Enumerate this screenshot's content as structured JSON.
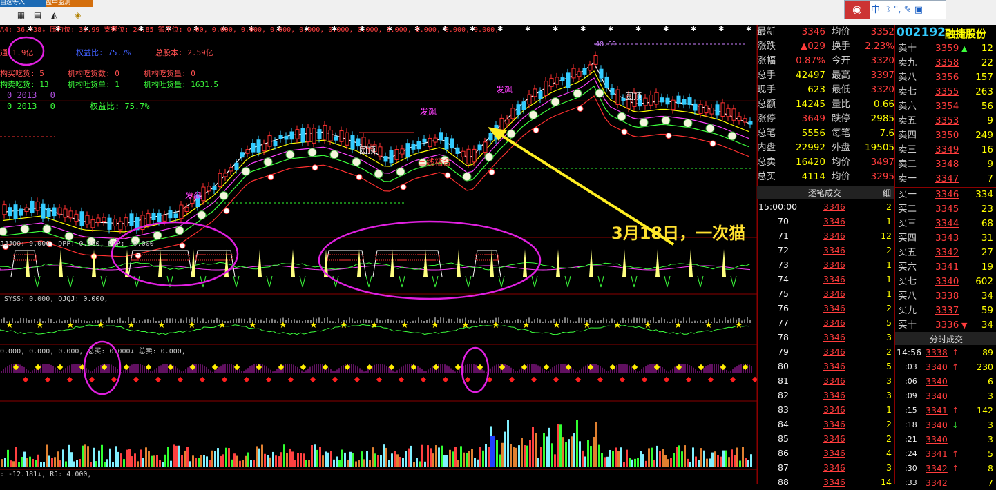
{
  "tabs": [
    {
      "label": "自选等入"
    },
    {
      "label": "盘中监测"
    }
  ],
  "toolbar": {
    "icons": [
      "grid-icon",
      "chat-icon",
      "chart-icon",
      "diamond-icon"
    ]
  },
  "qq": {
    "tools": "中 ☽ °, ✎ ▣"
  },
  "chart": {
    "header_line1": "A4: 36.438↓ 压力位: 36.99 支撑位: 24.85 警示位: 0.00, 0.000, 0.000, 0.000, 0.000, 0.000, 0.000, 0.000, 0.000, 0.000, 0.000,",
    "info": [
      {
        "text": "通 1.9亿",
        "color": "#ff5050"
      },
      {
        "text": "权益比: 75.7%",
        "color": "#4060ff"
      },
      {
        "text": "总股本: 2.59亿",
        "color": "#ff5050"
      },
      {
        "text": "构买吃货: 5",
        "color": "#ff5050"
      },
      {
        "text": "机构吃货数: 0",
        "color": "#ff5050"
      },
      {
        "text": "机构吃货量: 0",
        "color": "#ff5050"
      },
      {
        "text": "构卖吃货: 13",
        "color": "#3cff3c"
      },
      {
        "text": "机构吐货单: 1",
        "color": "#3cff3c"
      },
      {
        "text": "机构吐货量: 1631.5",
        "color": "#3cff3c"
      },
      {
        "text": "0   2013一 0",
        "color": "#b050e0"
      },
      {
        "text": "0   2013一 0",
        "color": "#3cff3c"
      },
      {
        "text": "权益比: 75.7%",
        "color": "#3cff3c"
      }
    ],
    "price_top": "48.69",
    "labels_main": [
      "圆顶",
      "发飙",
      "发飙",
      "三线粘合",
      "发飙",
      "圆顶"
    ],
    "header_jjjoo": "JJJOO: 9.000, DPP: 0.000, DPP: -0.000",
    "header_syss": "SYSS: 0.000, QJQJ: 0.000,",
    "header_buy": "0.000, 0.000, 0.000, 总买: 0.000↓ 总卖: 0.000,",
    "header_bottom": ": -12.181↓, RJ: 4.000,",
    "annotation": "3月18日，一次猫"
  },
  "quote": {
    "code": "002192",
    "name": "融捷股份",
    "left": [
      {
        "label": "最新",
        "value": "3346",
        "label2": "均价",
        "value2": "3352"
      },
      {
        "label": "涨跌",
        "value": "▲029",
        "label2": "换手",
        "value2": "2.23%"
      },
      {
        "label": "涨幅",
        "value": "0.87%",
        "label2": "今开",
        "value2": "3320"
      },
      {
        "label": "总手",
        "value": "42497",
        "label2": "最高",
        "value2": "3397"
      },
      {
        "label": "现手",
        "value": "623",
        "label2": "最低",
        "value2": "3320"
      },
      {
        "label": "总额",
        "value": "14245",
        "label2": "量比",
        "value2": "0.66"
      },
      {
        "label": "涨停",
        "value": "3649",
        "label2": "跌停",
        "value2": "2985"
      },
      {
        "label": "总笔",
        "value": "5556",
        "label2": "每笔",
        "value2": "7.6"
      },
      {
        "label": "内盘",
        "value": "22992",
        "label2": "外盘",
        "value2": "19505"
      },
      {
        "label": "总卖",
        "value": "16420",
        "label2": "均价",
        "value2": "3497"
      },
      {
        "label": "总买",
        "value": "4114",
        "label2": "均价",
        "value2": "3295"
      }
    ],
    "sell": [
      {
        "label": "卖十",
        "price": "3359",
        "mark": "▲",
        "vol": "12"
      },
      {
        "label": "卖九",
        "price": "3358",
        "mark": "",
        "vol": "22"
      },
      {
        "label": "卖八",
        "price": "3356",
        "mark": "",
        "vol": "157"
      },
      {
        "label": "卖七",
        "price": "3355",
        "mark": "",
        "vol": "263"
      },
      {
        "label": "卖六",
        "price": "3354",
        "mark": "",
        "vol": "56"
      },
      {
        "label": "卖五",
        "price": "3353",
        "mark": "",
        "vol": "9"
      },
      {
        "label": "卖四",
        "price": "3350",
        "mark": "",
        "vol": "249"
      },
      {
        "label": "卖三",
        "price": "3349",
        "mark": "",
        "vol": "16"
      },
      {
        "label": "卖二",
        "price": "3348",
        "mark": "",
        "vol": "9"
      },
      {
        "label": "卖一",
        "price": "3347",
        "mark": "",
        "vol": "7"
      }
    ],
    "buy": [
      {
        "label": "买一",
        "price": "3346",
        "vol": "334"
      },
      {
        "label": "买二",
        "price": "3345",
        "vol": "23"
      },
      {
        "label": "买三",
        "price": "3344",
        "vol": "68"
      },
      {
        "label": "买四",
        "price": "3343",
        "vol": "31"
      },
      {
        "label": "买五",
        "price": "3342",
        "vol": "27"
      },
      {
        "label": "买六",
        "price": "3341",
        "vol": "19"
      },
      {
        "label": "买七",
        "price": "3340",
        "vol": "602"
      },
      {
        "label": "买八",
        "price": "3338",
        "vol": "34"
      },
      {
        "label": "买九",
        "price": "3337",
        "vol": "59"
      },
      {
        "label": "买十",
        "price": "3336",
        "mark": "▼",
        "vol": "34"
      }
    ],
    "ticks_header": "逐笔成交",
    "ticks_detail": "细",
    "ticks": [
      {
        "time": "15:00:00",
        "price": "3346",
        "vol": "2"
      },
      {
        "time": "70",
        "price": "3346",
        "vol": "1"
      },
      {
        "time": "71",
        "price": "3346",
        "vol": "12"
      },
      {
        "time": "72",
        "price": "3346",
        "vol": "2"
      },
      {
        "time": "73",
        "price": "3346",
        "vol": "1"
      },
      {
        "time": "74",
        "price": "3346",
        "vol": "1"
      },
      {
        "time": "75",
        "price": "3346",
        "vol": "1"
      },
      {
        "time": "76",
        "price": "3346",
        "vol": "2"
      },
      {
        "time": "77",
        "price": "3346",
        "vol": "5"
      },
      {
        "time": "78",
        "price": "3346",
        "vol": "3"
      },
      {
        "time": "79",
        "price": "3346",
        "vol": "2"
      },
      {
        "time": "80",
        "price": "3346",
        "vol": "5"
      },
      {
        "time": "81",
        "price": "3346",
        "vol": "3"
      },
      {
        "time": "82",
        "price": "3346",
        "vol": "3"
      },
      {
        "time": "83",
        "price": "3346",
        "vol": "1"
      },
      {
        "time": "84",
        "price": "3346",
        "vol": "2"
      },
      {
        "time": "85",
        "price": "3346",
        "vol": "2"
      },
      {
        "time": "86",
        "price": "3346",
        "vol": "4"
      },
      {
        "time": "87",
        "price": "3346",
        "vol": "3"
      },
      {
        "time": "88",
        "price": "3346",
        "vol": "14"
      }
    ],
    "minute_header": "分时成交",
    "minute": [
      {
        "time": "14:56",
        "price": "3338",
        "mark": "↑",
        "vol": "89"
      },
      {
        "time": ":03",
        "price": "3340",
        "mark": "↑",
        "vol": "230"
      },
      {
        "time": ":06",
        "price": "3340",
        "mark": "",
        "vol": "6"
      },
      {
        "time": ":09",
        "price": "3340",
        "mark": "",
        "vol": "3"
      },
      {
        "time": ":15",
        "price": "3341",
        "mark": "↑",
        "vol": "142"
      },
      {
        "time": ":18",
        "price": "3340",
        "mark": "↓",
        "vol": "3"
      },
      {
        "time": ":21",
        "price": "3340",
        "mark": "",
        "vol": "3"
      },
      {
        "time": ":24",
        "price": "3341",
        "mark": "↑",
        "vol": "5"
      },
      {
        "time": ":30",
        "price": "3342",
        "mark": "↑",
        "vol": "8"
      },
      {
        "time": ":33",
        "price": "3342",
        "mark": "",
        "vol": "7"
      }
    ]
  }
}
